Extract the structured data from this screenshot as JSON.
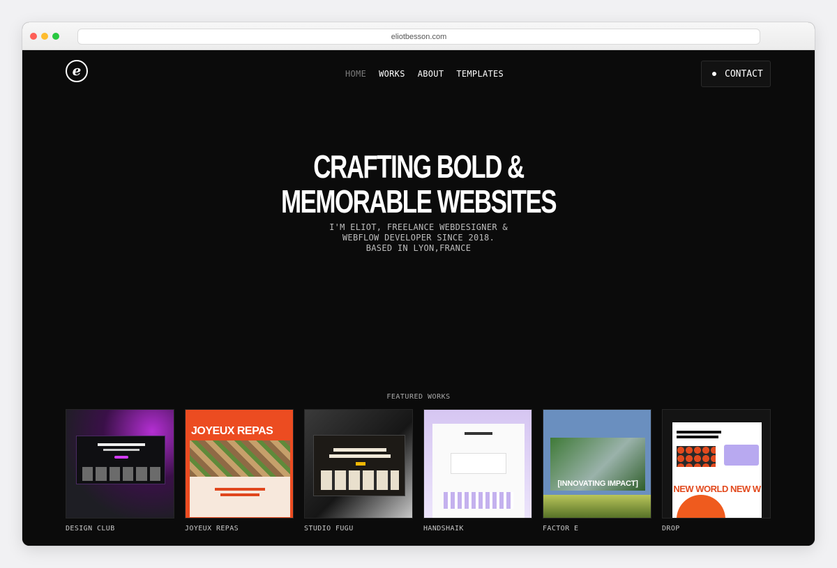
{
  "browser": {
    "url": "eliotbesson.com"
  },
  "header": {
    "logo_letter": "e",
    "nav": [
      {
        "label": "HOME",
        "active": true
      },
      {
        "label": "WORKS",
        "active": false
      },
      {
        "label": "ABOUT",
        "active": false
      },
      {
        "label": "TEMPLATES",
        "active": false
      }
    ],
    "contact_label": "CONTACT"
  },
  "hero": {
    "title_line1": "CRAFTING BOLD &",
    "title_line2": "MEMORABLE WEBSITES",
    "sub_line1": "I'M ELIOT, FREELANCE WEBDESIGNER &",
    "sub_line2": "WEBFLOW DEVELOPER SINCE 2018.",
    "sub_line3": "BASED IN LYON,FRANCE"
  },
  "featured": {
    "label": "FEATURED WORKS",
    "works": [
      {
        "name": "DESIGN CLUB"
      },
      {
        "name": "JOYEUX REPAS",
        "thumb_text": "JOYEUX REPAS"
      },
      {
        "name": "STUDIO FUGU"
      },
      {
        "name": "HANDSHAIK"
      },
      {
        "name": "FACTOR E",
        "thumb_text": "[INNOVATING IMPACT]"
      },
      {
        "name": "DROP",
        "thumb_text": "NEW WORLD NEW W"
      }
    ]
  },
  "colors": {
    "background": "#0b0b0b",
    "text": "#ffffff",
    "nav_active": "#7c7c7c"
  }
}
